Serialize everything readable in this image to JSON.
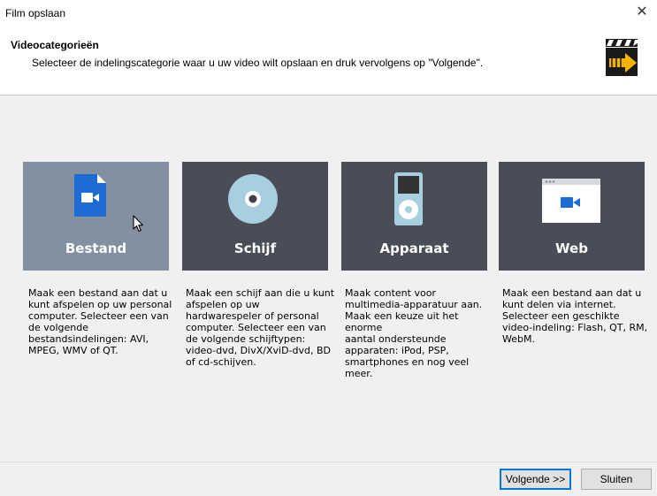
{
  "window": {
    "title": "Film opslaan",
    "close_glyph": "✕"
  },
  "header": {
    "title": "Videocategorieën",
    "subtitle": "Selecteer de indelingscategorie waar u uw video wilt opslaan en druk vervolgens op \"Volgende\".",
    "logo_icon": "clapperboard-arrow-icon"
  },
  "categories": [
    {
      "label": "Bestand",
      "icon": "file-video-icon",
      "selected": true,
      "description": [
        "Maak een bestand aan dat u",
        "kunt afspelen op uw personal",
        "computer. Selecteer een van",
        "de volgende",
        "bestandsindelingen: AVI,",
        "MPEG, WMV of QT."
      ]
    },
    {
      "label": "Schijf",
      "icon": "disc-icon",
      "selected": false,
      "description": [
        "Maak een schijf aan die u kunt",
        "afspelen op uw",
        "hardwarespeler of personal",
        "computer. Selecteer een van",
        "de volgende schijftypen:",
        "video-dvd, DivX/XviD-dvd, BD",
        "of cd-schijven."
      ]
    },
    {
      "label": "Apparaat",
      "icon": "media-player-device-icon",
      "selected": false,
      "description": [
        "Maak content voor",
        "multimedia-apparatuur aan.",
        "Maak een keuze uit het enorme",
        "aantal ondersteunde",
        "apparaten: iPod, PSP,",
        "smartphones en nog veel",
        "meer."
      ]
    },
    {
      "label": "Web",
      "icon": "browser-video-icon",
      "selected": false,
      "description": [
        "Maak een bestand aan dat u",
        "kunt delen via internet.",
        "Selecteer een geschikte",
        "video-indeling: Flash, QT,  RM,",
        "WebM."
      ]
    }
  ],
  "buttons": {
    "next": "Volgende >>",
    "close": "Sluiten"
  },
  "colors": {
    "card": "#4a4d58",
    "card_selected": "#8290a2",
    "accent_blue": "#1e6bd6",
    "disc": "#a8cfe0",
    "primary_border": "#0078d7"
  }
}
